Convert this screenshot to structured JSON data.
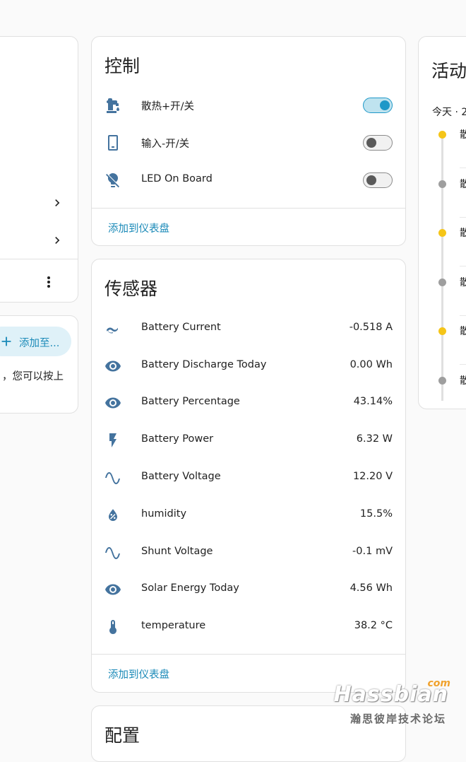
{
  "left_card": {
    "add_button_label": "添加至...",
    "hint_text": "，您可以按上"
  },
  "controls": {
    "title": "控制",
    "items": [
      {
        "label": "散热+开/关",
        "icon": "water-pump-icon",
        "state": "on"
      },
      {
        "label": "输入-开/关",
        "icon": "cellphone-icon",
        "state": "off"
      },
      {
        "label": "LED On Board",
        "icon": "lightbulb-off-icon",
        "state": "off"
      }
    ],
    "add_to_dashboard": "添加到仪表盘"
  },
  "sensors": {
    "title": "传感器",
    "items": [
      {
        "label": "Battery Current",
        "value": "-0.518 A",
        "icon": "current-ac-icon"
      },
      {
        "label": "Battery Discharge Today",
        "value": "0.00 Wh",
        "icon": "eye-icon"
      },
      {
        "label": "Battery Percentage",
        "value": "43.14%",
        "icon": "eye-icon"
      },
      {
        "label": "Battery Power",
        "value": "6.32 W",
        "icon": "flash-icon"
      },
      {
        "label": "Battery Voltage",
        "value": "12.20 V",
        "icon": "sine-wave-icon"
      },
      {
        "label": "humidity",
        "value": "15.5%",
        "icon": "water-percent-icon"
      },
      {
        "label": "Shunt Voltage",
        "value": "-0.1 mV",
        "icon": "sine-wave-icon"
      },
      {
        "label": "Solar Energy Today",
        "value": "4.56 Wh",
        "icon": "eye-icon"
      },
      {
        "label": "temperature",
        "value": "38.2 °C",
        "icon": "thermometer-icon"
      }
    ],
    "add_to_dashboard": "添加到仪表盘"
  },
  "config": {
    "title": "配置"
  },
  "activity": {
    "title": "活动",
    "date_label": "今天 · 2",
    "entries": [
      {
        "text": "散",
        "color": "#f5c518"
      },
      {
        "text": "散",
        "color": "#9e9e9e"
      },
      {
        "text": "散",
        "color": "#f5c518"
      },
      {
        "text": "散",
        "color": "#9e9e9e"
      },
      {
        "text": "散",
        "color": "#f5c518"
      },
      {
        "text": "散",
        "color": "#9e9e9e"
      }
    ]
  },
  "watermark": {
    "brand": "Hassbian",
    "tld": "com",
    "subtitle": "瀚思彼岸技术论坛"
  }
}
